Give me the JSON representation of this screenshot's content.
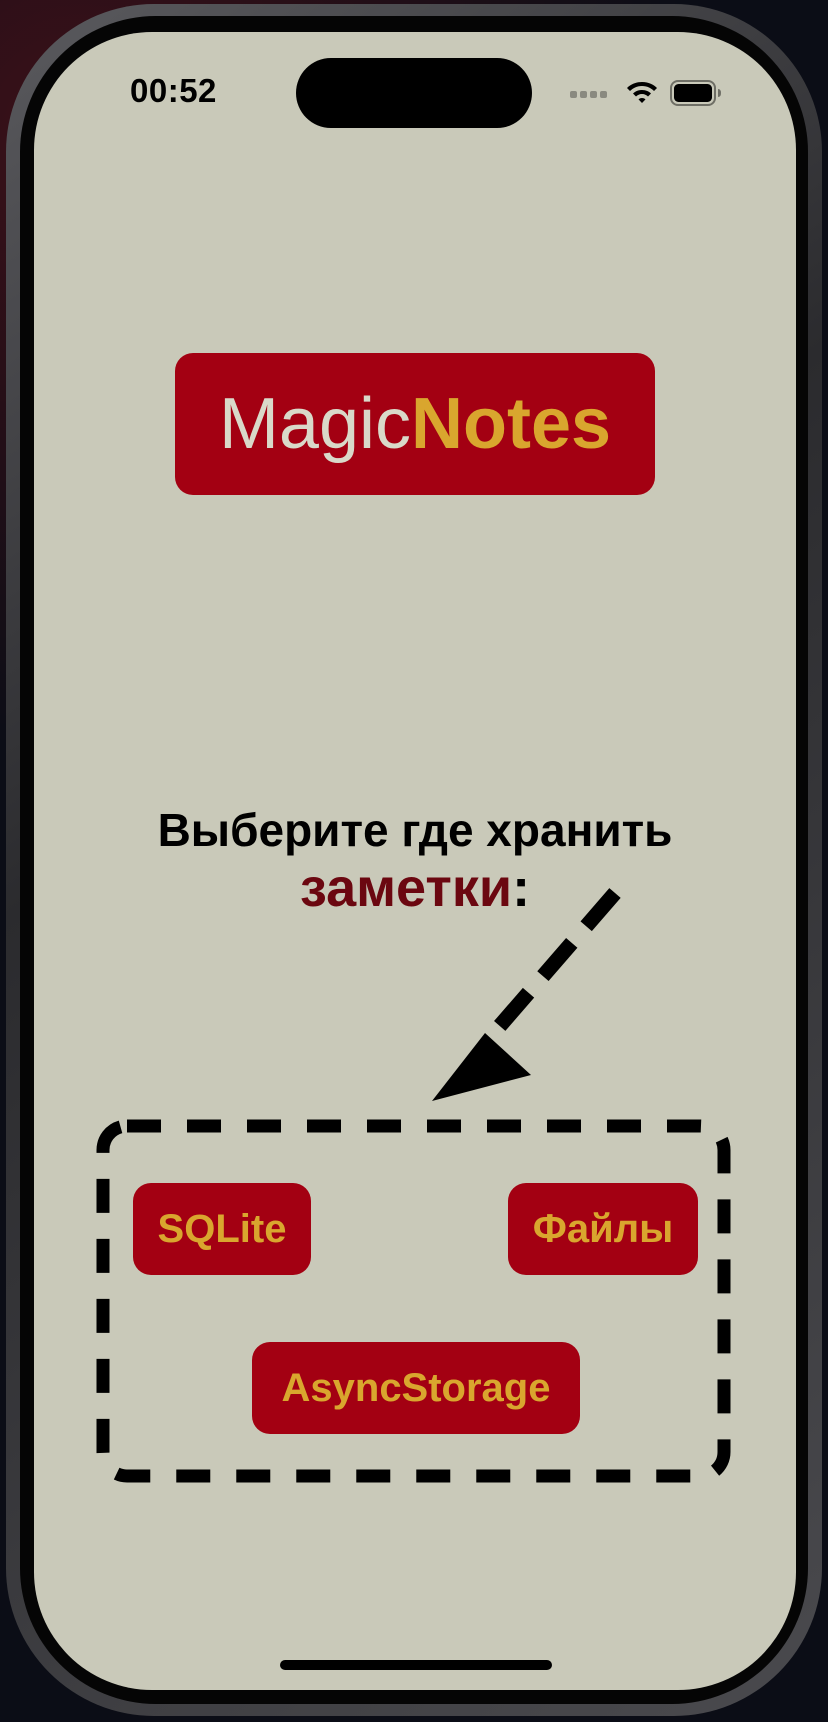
{
  "status_bar": {
    "time": "00:52",
    "icons": [
      "cellular-signal-icon",
      "wifi-icon",
      "battery-icon"
    ]
  },
  "logo": {
    "part1": "Magic",
    "part2": "Notes"
  },
  "prompt": {
    "line1": "Выберите где хранить",
    "line2_accent": "заметки",
    "line2_suffix": ":"
  },
  "storage_options": {
    "sqlite": "SQLite",
    "files": "Файлы",
    "async_storage": "AsyncStorage"
  },
  "colors": {
    "background": "#c9c9b9",
    "brand_red": "#a30012",
    "accent_gold": "#d9a62e",
    "accent_dark_red": "#6b0710"
  }
}
